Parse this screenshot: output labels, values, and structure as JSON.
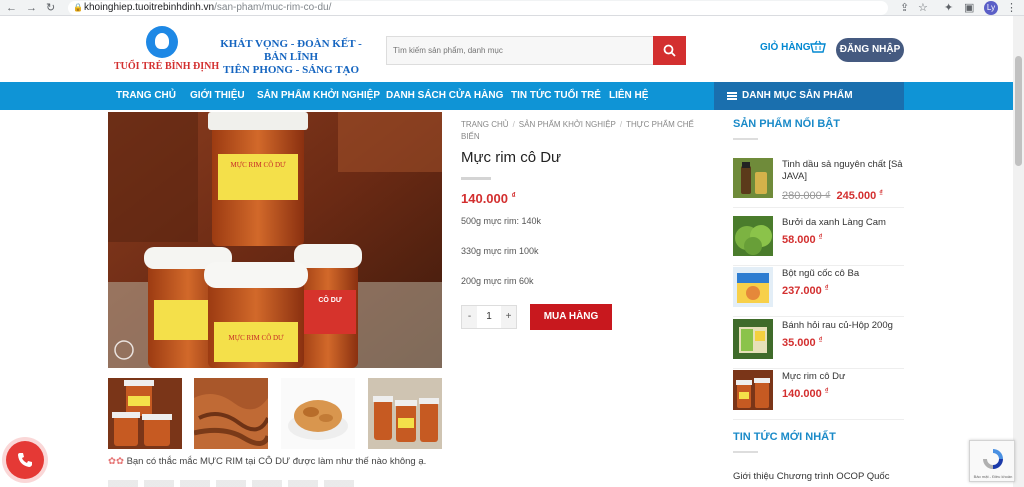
{
  "browser": {
    "url_host": "khoinghiep.tuoitrebinhdinh.vn",
    "url_path": "/san-pham/muc-rim-co-du/",
    "profile_initials": "Ly"
  },
  "header": {
    "logo_text": "TUỔI TRẺ BÌNH ĐỊNH",
    "slogan_line1": "KHÁT VỌNG - ĐOÀN KẾT - BẢN LĨNH",
    "slogan_line2": "TIÊN PHONG - SÁNG TẠO",
    "search_placeholder": "Tìm kiếm sản phẩm, danh mục",
    "cart_label": "GIỎ HÀNG",
    "login_label": "ĐĂNG NHẬP"
  },
  "nav": {
    "items": [
      "TRANG CHỦ",
      "GIỚI THIỆU",
      "SẢN PHẨM KHỞI NGHIỆP",
      "DANH SÁCH CỬA HÀNG",
      "TIN TỨC TUỔI TRẺ",
      "LIÊN HỆ"
    ],
    "category_menu": "DANH MỤC SẢN PHẨM"
  },
  "product": {
    "breadcrumb": [
      "TRANG CHỦ",
      "SẢN PHẨM KHỞI NGHIỆP",
      "THỰC PHẨM CHẾ BIẾN"
    ],
    "title": "Mực rim cô Dư",
    "price": "140.000",
    "currency": "₫",
    "variants": [
      "500g mực rim: 140k",
      "330g mực rim 100k",
      "200g mực rim 60k"
    ],
    "qty_minus": "-",
    "qty_value": "1",
    "qty_plus": "+",
    "buy_label": "MUA HÀNG",
    "description": "Bạn có thắc mắc MỰC RIM tại CÔ DƯ được làm như thế nào không ạ."
  },
  "sidebar": {
    "featured_title": "SẢN PHẨM NỔI BẬT",
    "items": [
      {
        "name": "Tinh dầu sả nguyên chất [Sả JAVA]",
        "old_price": "280.000 ₫",
        "price": "245.000",
        "currency": "₫"
      },
      {
        "name": "Bưởi da xanh Làng Cam",
        "price": "58.000",
        "currency": "₫"
      },
      {
        "name": "Bột ngũ cốc cô Ba",
        "price": "237.000",
        "currency": "₫"
      },
      {
        "name": "Bánh hỏi rau củ-Hộp 200g",
        "price": "35.000",
        "currency": "₫"
      },
      {
        "name": "Mực rim cô Dư",
        "price": "140.000",
        "currency": "₫"
      }
    ],
    "news_title": "TIN TỨC MỚI NHẤT",
    "news_first": "Giới thiệu Chương trình OCOP Quốc"
  },
  "recaptcha_text": "Bảo mật - Điều khoản",
  "colors": {
    "brand_blue": "#0f94d6",
    "price_red": "#d32f2f",
    "button_red": "#c8181e"
  }
}
